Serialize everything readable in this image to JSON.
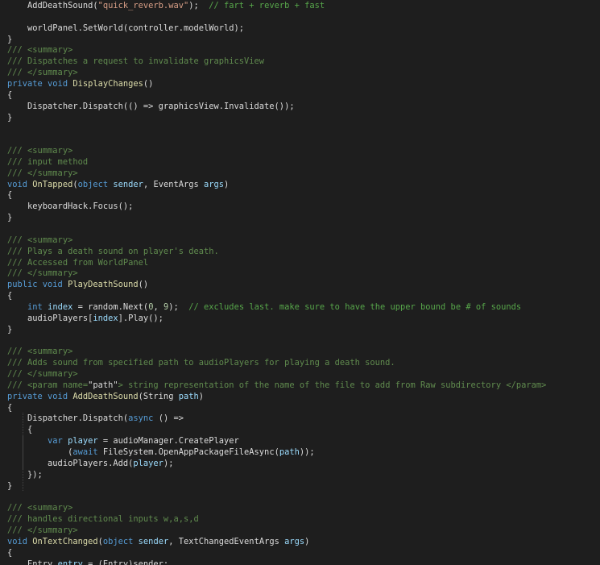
{
  "colors": {
    "background": "#1e1e1e",
    "text": "#dcdcdc",
    "keyword": "#569cd6",
    "type": "#4ec9b0",
    "function": "#dcdcaa",
    "string": "#d69d85",
    "comment": "#57a64a",
    "doc_comment": "#608b4e",
    "number": "#b5cea8",
    "parameter": "#9cdcfe",
    "indent_guide": "#454545"
  },
  "lines": [
    {
      "t": [
        [
          "plain",
          "    AddDeathSound("
        ],
        [
          "str",
          "\"quick_reverb.wav\""
        ],
        [
          "plain",
          ");  "
        ],
        [
          "cmt",
          "// fart + reverb + fast"
        ]
      ]
    },
    {
      "t": []
    },
    {
      "t": [
        [
          "plain",
          "    worldPanel.SetWorld(controller.modelWorld);"
        ]
      ]
    },
    {
      "t": [
        [
          "plain",
          "}"
        ]
      ]
    },
    {
      "t": [
        [
          "doc",
          "/// <summary>"
        ]
      ]
    },
    {
      "t": [
        [
          "doc",
          "/// Dispatches a request to invalidate graphicsView"
        ]
      ]
    },
    {
      "t": [
        [
          "doc",
          "/// </summary>"
        ]
      ]
    },
    {
      "t": [
        [
          "kw",
          "private void "
        ],
        [
          "fn",
          "DisplayChanges"
        ],
        [
          "plain",
          "()"
        ]
      ]
    },
    {
      "t": [
        [
          "plain",
          "{"
        ]
      ]
    },
    {
      "t": [
        [
          "plain",
          "    Dispatcher.Dispatch(() => graphicsView.Invalidate());"
        ]
      ]
    },
    {
      "t": [
        [
          "plain",
          "}"
        ]
      ]
    },
    {
      "t": []
    },
    {
      "t": []
    },
    {
      "t": [
        [
          "doc",
          "/// <summary>"
        ]
      ]
    },
    {
      "t": [
        [
          "doc",
          "/// input method"
        ]
      ]
    },
    {
      "t": [
        [
          "doc",
          "/// </summary>"
        ]
      ]
    },
    {
      "t": [
        [
          "kw",
          "void "
        ],
        [
          "fn",
          "OnTapped"
        ],
        [
          "plain",
          "("
        ],
        [
          "kw",
          "object "
        ],
        [
          "par",
          "sender"
        ],
        [
          "plain",
          ", EventArgs "
        ],
        [
          "par",
          "args"
        ],
        [
          "plain",
          ")"
        ]
      ]
    },
    {
      "t": [
        [
          "plain",
          "{"
        ]
      ]
    },
    {
      "t": [
        [
          "plain",
          "    keyboardHack.Focus();"
        ]
      ]
    },
    {
      "t": [
        [
          "plain",
          "}"
        ]
      ]
    },
    {
      "t": []
    },
    {
      "t": [
        [
          "doc",
          "/// <summary>"
        ]
      ]
    },
    {
      "t": [
        [
          "doc",
          "/// Plays a death sound on player's death."
        ]
      ]
    },
    {
      "t": [
        [
          "doc",
          "/// Accessed from WorldPanel"
        ]
      ]
    },
    {
      "t": [
        [
          "doc",
          "/// </summary>"
        ]
      ]
    },
    {
      "t": [
        [
          "kw",
          "public void "
        ],
        [
          "fn",
          "PlayDeathSound"
        ],
        [
          "plain",
          "()"
        ]
      ]
    },
    {
      "t": [
        [
          "plain",
          "{"
        ]
      ]
    },
    {
      "t": [
        [
          "plain",
          "    "
        ],
        [
          "kw",
          "int "
        ],
        [
          "par",
          "index"
        ],
        [
          "plain",
          " = random.Next("
        ],
        [
          "num",
          "0"
        ],
        [
          "plain",
          ", "
        ],
        [
          "num",
          "9"
        ],
        [
          "plain",
          ");  "
        ],
        [
          "cmt",
          "// excludes last. make sure to have the upper bound be # of sounds"
        ]
      ]
    },
    {
      "t": [
        [
          "plain",
          "    audioPlayers["
        ],
        [
          "par",
          "index"
        ],
        [
          "plain",
          "].Play();"
        ]
      ]
    },
    {
      "t": [
        [
          "plain",
          "}"
        ]
      ]
    },
    {
      "t": []
    },
    {
      "t": [
        [
          "doc",
          "/// <summary>"
        ]
      ]
    },
    {
      "t": [
        [
          "doc",
          "/// Adds sound from specified path to audioPlayers for playing a death sound."
        ]
      ]
    },
    {
      "t": [
        [
          "doc",
          "/// </summary>"
        ]
      ]
    },
    {
      "t": [
        [
          "doc",
          "/// <param name="
        ],
        [
          "plain",
          "\"path\""
        ],
        [
          "doc",
          "> string representation of the name of the file to add from Raw subdirectory </param>"
        ]
      ]
    },
    {
      "t": [
        [
          "kw",
          "private void "
        ],
        [
          "fn",
          "AddDeathSound"
        ],
        [
          "plain",
          "(String "
        ],
        [
          "par",
          "path"
        ],
        [
          "plain",
          ")"
        ]
      ]
    },
    {
      "t": [
        [
          "plain",
          "{"
        ]
      ]
    },
    {
      "t": [
        [
          "plain",
          "    Dispatcher.Dispatch("
        ],
        [
          "kw",
          "async "
        ],
        [
          "plain",
          "() =>"
        ]
      ]
    },
    {
      "t": [
        [
          "plain",
          "    {"
        ]
      ]
    },
    {
      "t": [
        [
          "plain",
          "        "
        ],
        [
          "kw",
          "var "
        ],
        [
          "par",
          "player"
        ],
        [
          "plain",
          " = audioManager.CreatePlayer"
        ]
      ]
    },
    {
      "t": [
        [
          "plain",
          "            ("
        ],
        [
          "kw",
          "await "
        ],
        [
          "plain",
          "FileSystem.OpenAppPackageFileAsync("
        ],
        [
          "par",
          "path"
        ],
        [
          "plain",
          "));"
        ]
      ]
    },
    {
      "t": [
        [
          "plain",
          "        audioPlayers.Add("
        ],
        [
          "par",
          "player"
        ],
        [
          "plain",
          ");"
        ]
      ]
    },
    {
      "t": [
        [
          "plain",
          "    });"
        ]
      ]
    },
    {
      "t": [
        [
          "plain",
          "}"
        ]
      ]
    },
    {
      "t": []
    },
    {
      "t": [
        [
          "doc",
          "/// <summary>"
        ]
      ]
    },
    {
      "t": [
        [
          "doc",
          "/// handles directional inputs w,a,s,d"
        ]
      ]
    },
    {
      "t": [
        [
          "doc",
          "/// </summary>"
        ]
      ]
    },
    {
      "t": [
        [
          "kw",
          "void "
        ],
        [
          "fn",
          "OnTextChanged"
        ],
        [
          "plain",
          "("
        ],
        [
          "kw",
          "object "
        ],
        [
          "par",
          "sender"
        ],
        [
          "plain",
          ", TextChangedEventArgs "
        ],
        [
          "par",
          "args"
        ],
        [
          "plain",
          ")"
        ]
      ]
    },
    {
      "t": [
        [
          "plain",
          "{"
        ]
      ]
    },
    {
      "t": [
        [
          "plain",
          "    Entry "
        ],
        [
          "par",
          "entry"
        ],
        [
          "plain",
          " = (Entry)sender;"
        ]
      ]
    }
  ]
}
